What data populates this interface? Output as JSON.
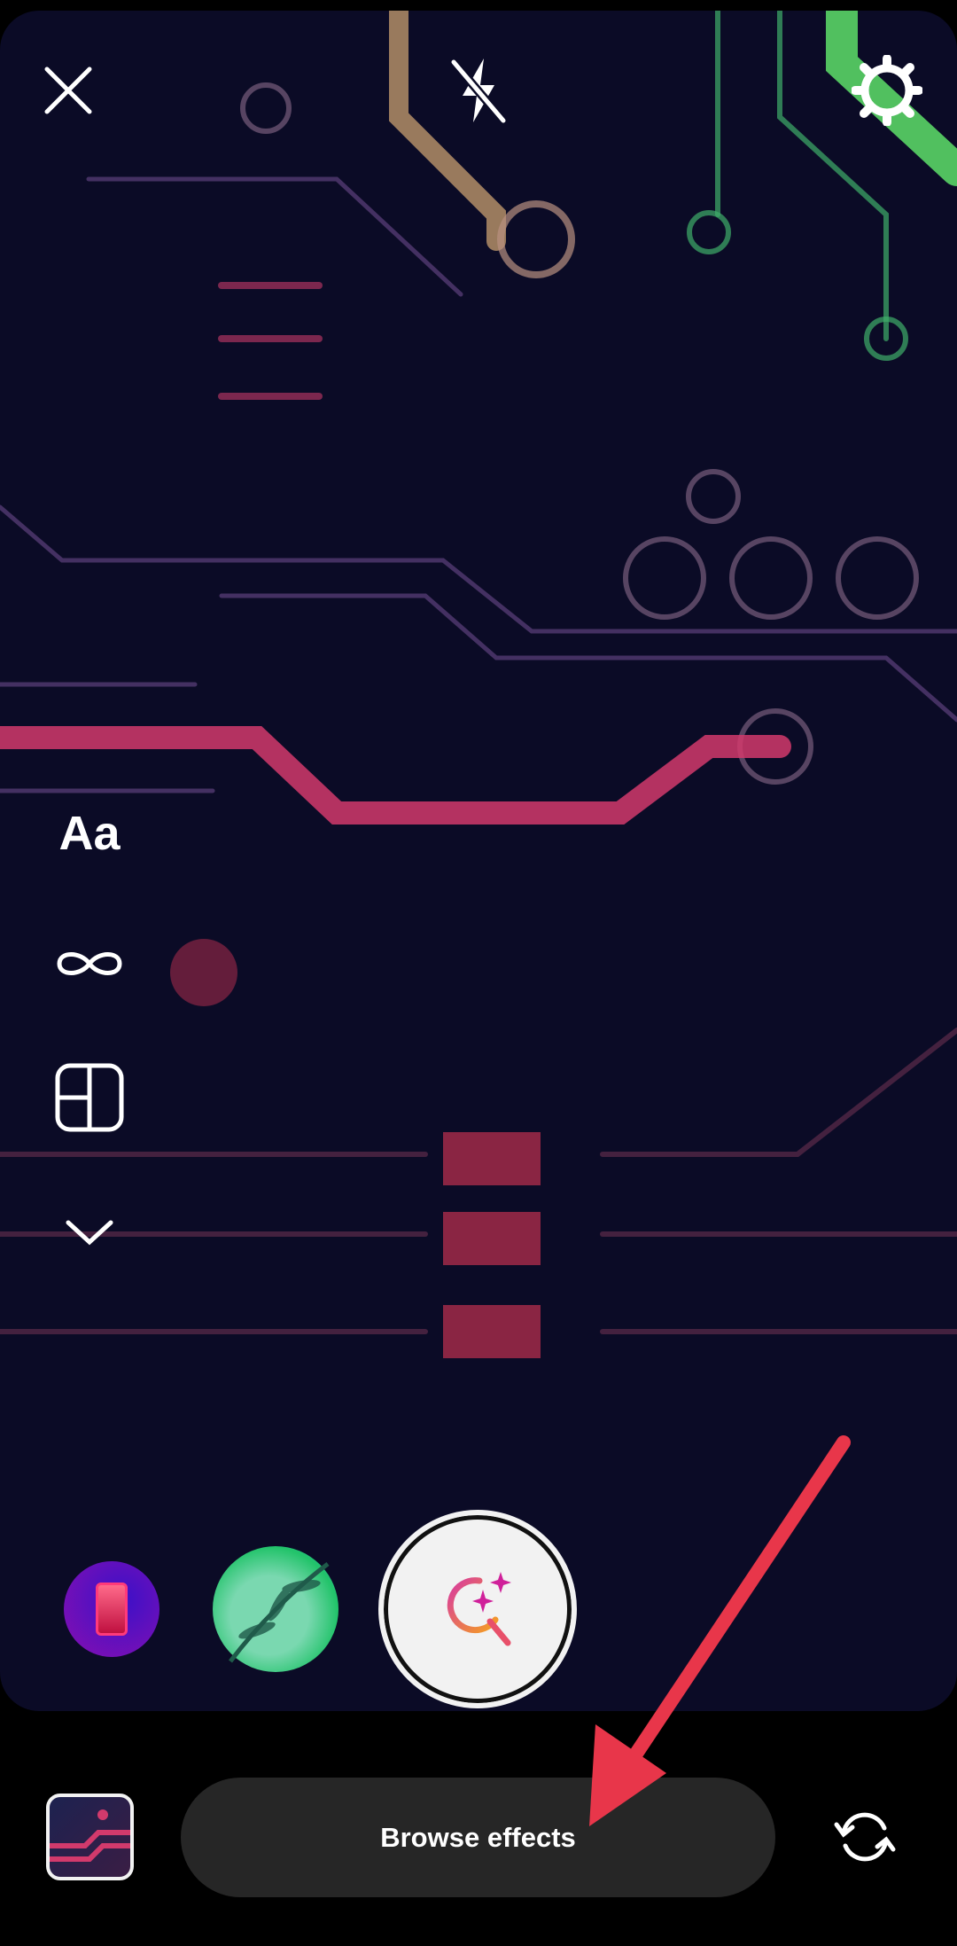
{
  "top_bar": {
    "close_icon": "close-icon",
    "flash_icon": "flash-off-icon",
    "settings_icon": "gear-icon"
  },
  "side_tools": {
    "text_label": "Aa",
    "boomerang_icon": "infinity-icon",
    "layout_icon": "layout-icon",
    "more_icon": "chevron-down-icon"
  },
  "effects": [
    {
      "name": "purple-phone-effect",
      "color": "#6a1fc0"
    },
    {
      "name": "green-leaf-effect",
      "color": "#22c36a"
    }
  ],
  "capture": {
    "icon": "search-sparkle-icon"
  },
  "bottom_bar": {
    "browse_label": "Browse effects",
    "gallery_icon": "gallery-thumbnail",
    "flip_icon": "camera-flip-icon"
  },
  "annotation": {
    "arrow_color": "#e8364a"
  }
}
